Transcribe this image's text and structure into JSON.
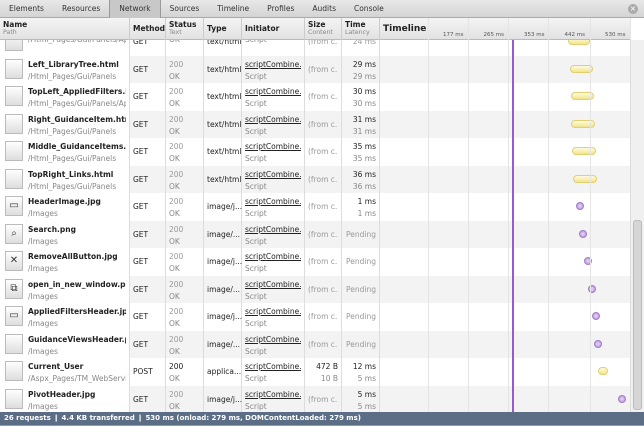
{
  "tabs": [
    "Elements",
    "Resources",
    "Network",
    "Sources",
    "Timeline",
    "Profiles",
    "Audits",
    "Console"
  ],
  "active_tab": "Network",
  "columns": {
    "name": "Name",
    "path": "Path",
    "method": "Method",
    "status": "Status",
    "text": "Text",
    "type": "Type",
    "initiator": "Initiator",
    "size": "Size",
    "content": "Content",
    "time": "Time",
    "latency": "Latency",
    "timeline": "Timeline"
  },
  "timeline_ticks": [
    "177 ms",
    "265 ms",
    "353 ms",
    "442 ms",
    "530 ms"
  ],
  "onload_ms": 279,
  "colors": {
    "onload_line": "#9b59d0",
    "status_bar": "#5c6e85",
    "html_bar": "#f2e48a",
    "image_dot": "#b48ad8"
  },
  "rows": [
    {
      "name": "",
      "path": "/Html_Pages/Gui/Panels/App",
      "method": "GET",
      "status": "",
      "text": "OK",
      "type": "text/html",
      "initiator": "",
      "init_type": "Script",
      "size": "(from c...",
      "content": "",
      "time": "",
      "latency": "24 ms",
      "icon": "document-icon",
      "bar": [
        402,
        452
      ],
      "kind": "bar"
    },
    {
      "name": "Left_LibraryTree.html",
      "path": "/Html_Pages/Gui/Panels",
      "method": "GET",
      "status": "200",
      "text": "OK",
      "type": "text/html",
      "initiator": "scriptCombine...",
      "init_type": "Script",
      "size": "(from c...",
      "content": "",
      "time": "29 ms",
      "latency": "29 ms",
      "icon": "document-icon",
      "bar": [
        407,
        458
      ],
      "kind": "bar"
    },
    {
      "name": "TopLeft_AppliedFilters.html",
      "path": "/Html_Pages/Gui/Panels/App",
      "method": "GET",
      "status": "200",
      "text": "OK",
      "type": "text/html",
      "initiator": "scriptCombine...",
      "init_type": "Script",
      "size": "(from c...",
      "content": "",
      "time": "30 ms",
      "latency": "30 ms",
      "icon": "document-icon",
      "bar": [
        409,
        460
      ],
      "kind": "bar"
    },
    {
      "name": "Right_GuidanceItem.html",
      "path": "/Html_Pages/Gui/Panels",
      "method": "GET",
      "status": "200",
      "text": "OK",
      "type": "text/html",
      "initiator": "scriptCombine...",
      "init_type": "Script",
      "size": "(from c...",
      "content": "",
      "time": "31 ms",
      "latency": "31 ms",
      "icon": "document-icon",
      "bar": [
        409,
        462
      ],
      "kind": "bar"
    },
    {
      "name": "Middle_GuidanceItems.html",
      "path": "/Html_Pages/Gui/Panels",
      "method": "GET",
      "status": "200",
      "text": "OK",
      "type": "text/html",
      "initiator": "scriptCombine...",
      "init_type": "Script",
      "size": "(from c...",
      "content": "",
      "time": "35 ms",
      "latency": "35 ms",
      "icon": "document-icon",
      "bar": [
        411,
        464
      ],
      "kind": "bar"
    },
    {
      "name": "TopRight_Links.html",
      "path": "/Html_Pages/Gui/Panels",
      "method": "GET",
      "status": "200",
      "text": "OK",
      "type": "text/html",
      "initiator": "scriptCombine...",
      "init_type": "Script",
      "size": "(from c...",
      "content": "",
      "time": "36 ms",
      "latency": "36 ms",
      "icon": "document-icon",
      "bar": [
        413,
        466
      ],
      "kind": "bar"
    },
    {
      "name": "HeaderImage.jpg",
      "path": "/Images",
      "method": "GET",
      "status": "200",
      "text": "OK",
      "type": "image/j...",
      "initiator": "scriptCombine...",
      "init_type": "Script",
      "size": "(from c...",
      "content": "",
      "time": "1 ms",
      "latency": "1 ms",
      "icon": "image-thumbnail-icon",
      "bar": [
        429,
        429
      ],
      "kind": "dot"
    },
    {
      "name": "Search.png",
      "path": "/Images",
      "method": "GET",
      "status": "200",
      "text": "OK",
      "type": "image/...",
      "initiator": "scriptCombine...",
      "init_type": "Script",
      "size": "(from c...",
      "content": "",
      "time": "",
      "latency": "Pending",
      "icon": "search-icon",
      "bar": [
        436,
        436
      ],
      "kind": "dot"
    },
    {
      "name": "RemoveAllButton.jpg",
      "path": "/Images",
      "method": "GET",
      "status": "200",
      "text": "OK",
      "type": "image/j...",
      "initiator": "scriptCombine...",
      "init_type": "Script",
      "size": "(from c...",
      "content": "",
      "time": "",
      "latency": "Pending",
      "icon": "remove-icon",
      "bar": [
        447,
        447
      ],
      "kind": "dot"
    },
    {
      "name": "open_in_new_window.png",
      "path": "/Images",
      "method": "GET",
      "status": "200",
      "text": "OK",
      "type": "image/...",
      "initiator": "scriptCombine...",
      "init_type": "Script",
      "size": "(from c...",
      "content": "",
      "time": "",
      "latency": "Pending",
      "icon": "external-link-icon",
      "bar": [
        455,
        455
      ],
      "kind": "dot"
    },
    {
      "name": "AppliedFiltersHeader.jpg",
      "path": "/Images",
      "method": "GET",
      "status": "200",
      "text": "OK",
      "type": "image/j...",
      "initiator": "scriptCombine...",
      "init_type": "Script",
      "size": "(from c...",
      "content": "",
      "time": "",
      "latency": "Pending",
      "icon": "image-thumbnail-icon",
      "bar": [
        464,
        464
      ],
      "kind": "dot"
    },
    {
      "name": "GuidanceViewsHeader.png",
      "path": "/Images",
      "method": "GET",
      "status": "200",
      "text": "OK",
      "type": "image/...",
      "initiator": "scriptCombine...",
      "init_type": "Script",
      "size": "(from c...",
      "content": "",
      "time": "",
      "latency": "Pending",
      "icon": "document-icon",
      "bar": [
        469,
        469
      ],
      "kind": "dot"
    },
    {
      "name": "Current_User",
      "path": "/Aspx_Pages/TM_WebService",
      "method": "POST",
      "status": "200",
      "text": "OK",
      "type": "applica...",
      "initiator": "scriptCombine...",
      "init_type": "Script",
      "size": "472 B",
      "content": "10 B",
      "time": "12 ms",
      "latency": "5 ms",
      "icon": "document-icon",
      "bar": [
        469,
        490
      ],
      "kind": "bar"
    },
    {
      "name": "PivotHeader.jpg",
      "path": "/Images",
      "method": "GET",
      "status": "200",
      "text": "OK",
      "type": "image/j...",
      "initiator": "scriptCombine...",
      "init_type": "Script",
      "size": "(from c...",
      "content": "",
      "time": "5 ms",
      "latency": "5 ms",
      "icon": "document-icon",
      "bar": [
        521,
        521
      ],
      "kind": "dot"
    }
  ],
  "summary": "26 requests  ❙  4.4 KB transferred  ❙  530 ms (onload: 279 ms, DOMContentLoaded: 279 ms)"
}
